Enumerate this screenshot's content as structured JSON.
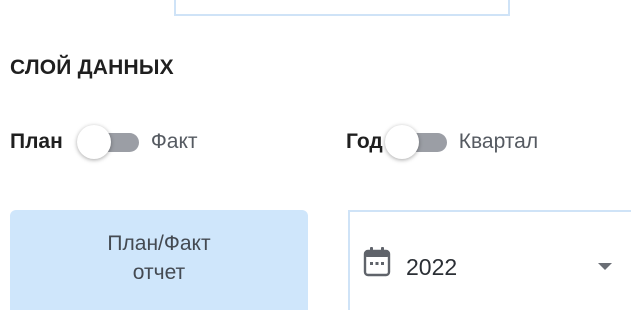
{
  "data_layer": {
    "title": "СЛОЙ ДАННЫХ"
  },
  "toggles": {
    "plan_fact": {
      "left_label": "План",
      "right_label": "Факт",
      "checked": false
    },
    "period": {
      "left_label": "Год",
      "right_label": "Квартал",
      "checked": false
    }
  },
  "report_button": {
    "label": "План/Факт\nотчет"
  },
  "year_select": {
    "value": "2022",
    "icon": "calendar-icon"
  },
  "colors": {
    "accent_light": "#cfe6fb",
    "field_border": "#cfe3f7",
    "switch_track": "#9b9ea5"
  }
}
